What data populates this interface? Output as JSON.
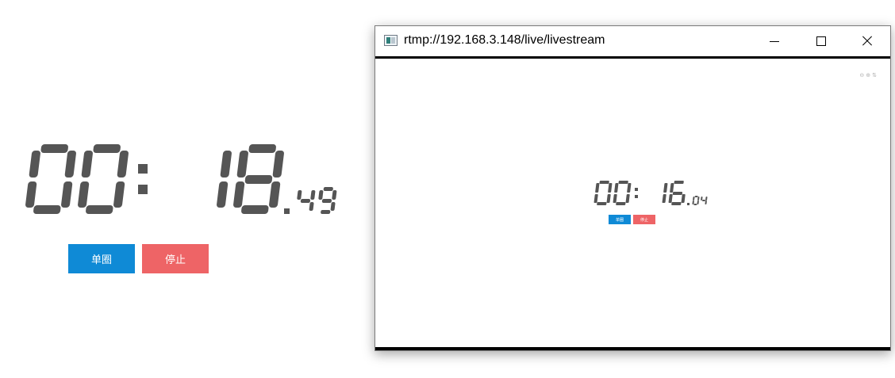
{
  "main_stopwatch": {
    "minutes": "00",
    "seconds": "18",
    "centiseconds": "49",
    "lap_label": "单圈",
    "stop_label": "停止"
  },
  "window": {
    "title": "rtmp://192.168.3.148/live/livestream",
    "controls": [
      "minimize-icon",
      "maximize-icon",
      "close-icon"
    ],
    "overlay_icons": [
      "⊖",
      "⊕",
      "⇅"
    ],
    "stopwatch": {
      "minutes": "00",
      "seconds": "16",
      "centiseconds": "04",
      "lap_label": "单圈",
      "stop_label": "停止"
    }
  },
  "colors": {
    "digits": "#555555",
    "lap_button": "#0f8ad6",
    "stop_button": "#ee6466",
    "titlebar_rule": "#000000"
  }
}
